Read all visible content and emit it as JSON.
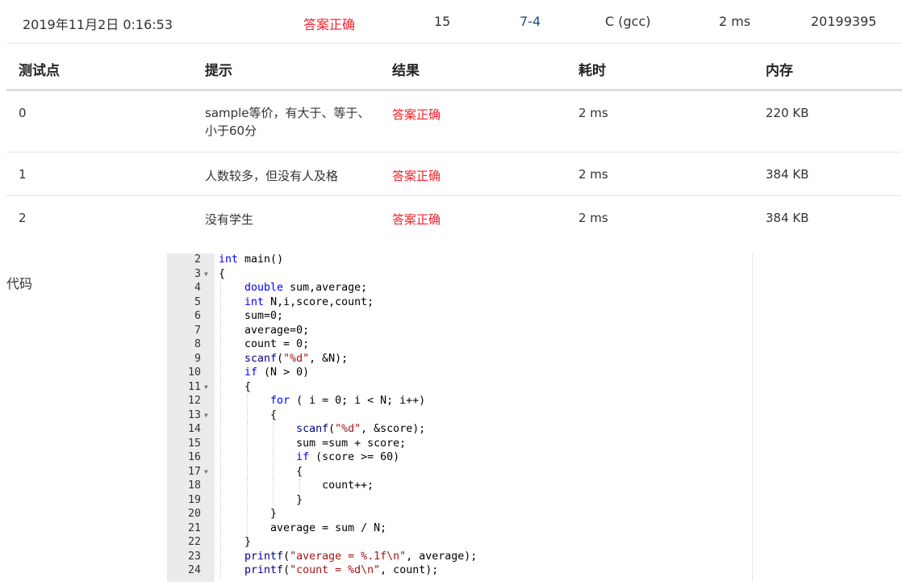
{
  "summary": {
    "time": "2019年11月2日 0:16:53",
    "status": "答案正确",
    "score": "15",
    "problem": "7-4",
    "compiler": "C (gcc)",
    "run_time": "2 ms",
    "user": "20199395"
  },
  "cases": {
    "headers": [
      "测试点",
      "提示",
      "结果",
      "耗时",
      "内存"
    ],
    "rows": [
      {
        "id": "0",
        "hint": "sample等价，有大于、等于、小于60分",
        "result": "答案正确",
        "time": "2 ms",
        "memory": "220 KB"
      },
      {
        "id": "1",
        "hint": "人数较多，但没有人及格",
        "result": "答案正确",
        "time": "2 ms",
        "memory": "384 KB"
      },
      {
        "id": "2",
        "hint": "没有学生",
        "result": "答案正确",
        "time": "2 ms",
        "memory": "384 KB"
      }
    ]
  },
  "code_section": {
    "label": "代码",
    "lines": [
      {
        "n": "2",
        "text": "int main()",
        "fold": false
      },
      {
        "n": "3",
        "text": "{",
        "fold": true
      },
      {
        "n": "4",
        "text": "    double sum,average;",
        "fold": false
      },
      {
        "n": "5",
        "text": "    int N,i,score,count;",
        "fold": false
      },
      {
        "n": "6",
        "text": "    sum=0;",
        "fold": false
      },
      {
        "n": "7",
        "text": "    average=0;",
        "fold": false
      },
      {
        "n": "8",
        "text": "    count = 0;",
        "fold": false
      },
      {
        "n": "9",
        "text": "    scanf(\"%d\", &N);",
        "fold": false
      },
      {
        "n": "10",
        "text": "    if (N > 0)",
        "fold": false
      },
      {
        "n": "11",
        "text": "    {",
        "fold": true
      },
      {
        "n": "12",
        "text": "        for ( i = 0; i < N; i++)",
        "fold": false
      },
      {
        "n": "13",
        "text": "        {",
        "fold": true
      },
      {
        "n": "14",
        "text": "            scanf(\"%d\", &score);",
        "fold": false
      },
      {
        "n": "15",
        "text": "            sum =sum + score;",
        "fold": false
      },
      {
        "n": "16",
        "text": "            if (score >= 60)",
        "fold": false
      },
      {
        "n": "17",
        "text": "            {",
        "fold": true
      },
      {
        "n": "18",
        "text": "                count++;",
        "fold": false
      },
      {
        "n": "19",
        "text": "            }",
        "fold": false
      },
      {
        "n": "20",
        "text": "        }",
        "fold": false
      },
      {
        "n": "21",
        "text": "        average = sum / N;",
        "fold": false
      },
      {
        "n": "22",
        "text": "    }",
        "fold": false
      },
      {
        "n": "23",
        "text": "    printf(\"average = %.1f\\n\", average);",
        "fold": false
      },
      {
        "n": "24",
        "text": "    printf(\"count = %d\\n\", count);",
        "fold": false
      }
    ]
  }
}
